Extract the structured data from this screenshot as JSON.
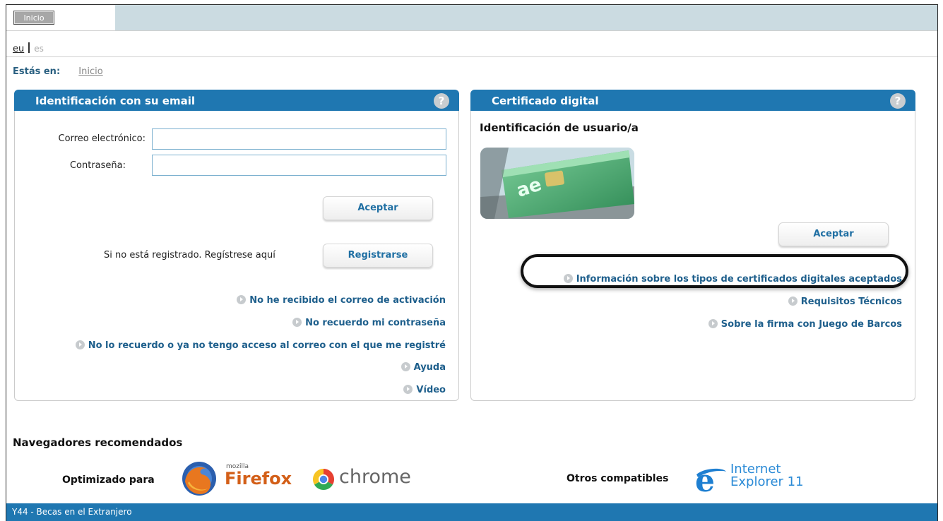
{
  "topbar": {
    "home_button": "Inicio"
  },
  "lang": {
    "eu": "eu",
    "es": "es"
  },
  "breadcrumb": {
    "label": "Estás en:",
    "link": "Inicio"
  },
  "email_panel": {
    "title": "Identificación con su email",
    "help": "?",
    "email_label": "Correo electrónico:",
    "email_value": "",
    "password_label": "Contraseña:",
    "password_value": "",
    "accept_label": "Aceptar",
    "register_prompt": "Si no está registrado. Regístrese aquí",
    "register_label": "Registrarse",
    "links": [
      "No he recibido el correo de activación",
      "No recuerdo mi contraseña",
      "No lo recuerdo o ya no tengo acceso al correo con el que me registré",
      "Ayuda",
      "Vídeo"
    ]
  },
  "cert_panel": {
    "title": "Certificado digital",
    "help": "?",
    "subtitle": "Identificación de usuario/a",
    "accept_label": "Aceptar",
    "links": [
      "Información sobre los tipos de certificados digitales aceptados",
      "Requisitos Técnicos",
      "Sobre la firma con Juego de Barcos"
    ]
  },
  "browsers": {
    "title": "Navegadores recomendados",
    "optimized_label": "Optimizado para",
    "firefox_small": "mozilla",
    "firefox_name": "Firefox",
    "chrome_name": "chrome",
    "other_label": "Otros compatibles",
    "ie_line1": "Internet",
    "ie_line2": "Explorer 11"
  },
  "footer": {
    "text": "Y44 - Becas en el Extranjero"
  },
  "colors": {
    "accent": "#1f77b1",
    "link": "#1e5f8c",
    "topbar": "#cbdbe1"
  }
}
